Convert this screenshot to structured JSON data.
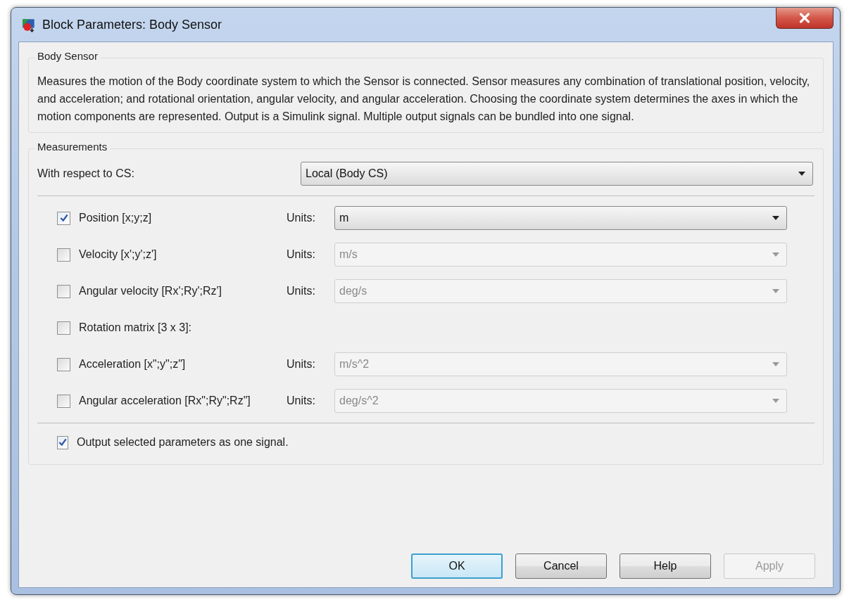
{
  "window": {
    "title": "Block Parameters: Body Sensor"
  },
  "description_group": {
    "title": "Body Sensor",
    "text": "Measures the motion of the Body coordinate system to which the Sensor is connected. Sensor measures any combination of translational position, velocity, and acceleration; and rotational orientation, angular velocity, and angular acceleration. Choosing the coordinate system determines the axes in which the motion components are represented. Output is a Simulink signal. Multiple output signals can be bundled into one signal."
  },
  "measurements": {
    "title": "Measurements",
    "reference": {
      "label": "With respect to CS:",
      "value": "Local (Body CS)"
    },
    "items": [
      {
        "label": "Position [x;y;z]",
        "checked": true,
        "units_label": "Units:",
        "units": "m",
        "disabled": false
      },
      {
        "label": "Velocity [x';y';z']",
        "checked": false,
        "units_label": "Units:",
        "units": "m/s",
        "disabled": true
      },
      {
        "label": "Angular velocity [Rx';Ry';Rz']",
        "checked": false,
        "units_label": "Units:",
        "units": "deg/s",
        "disabled": true
      },
      {
        "label": "Rotation matrix [3 x 3]:",
        "checked": false
      },
      {
        "label": "Acceleration [x\";y\";z\"]",
        "checked": false,
        "units_label": "Units:",
        "units": "m/s^2",
        "disabled": true
      },
      {
        "label": "Angular acceleration [Rx\";Ry\";Rz\"]",
        "checked": false,
        "units_label": "Units:",
        "units": "deg/s^2",
        "disabled": true
      }
    ],
    "output_option": {
      "label": "Output selected parameters as one signal.",
      "checked": true
    }
  },
  "buttons": [
    {
      "label": "OK",
      "default": true,
      "disabled": false
    },
    {
      "label": "Cancel",
      "default": false,
      "disabled": false
    },
    {
      "label": "Help",
      "default": false,
      "disabled": false
    },
    {
      "label": "Apply",
      "default": false,
      "disabled": true
    }
  ]
}
